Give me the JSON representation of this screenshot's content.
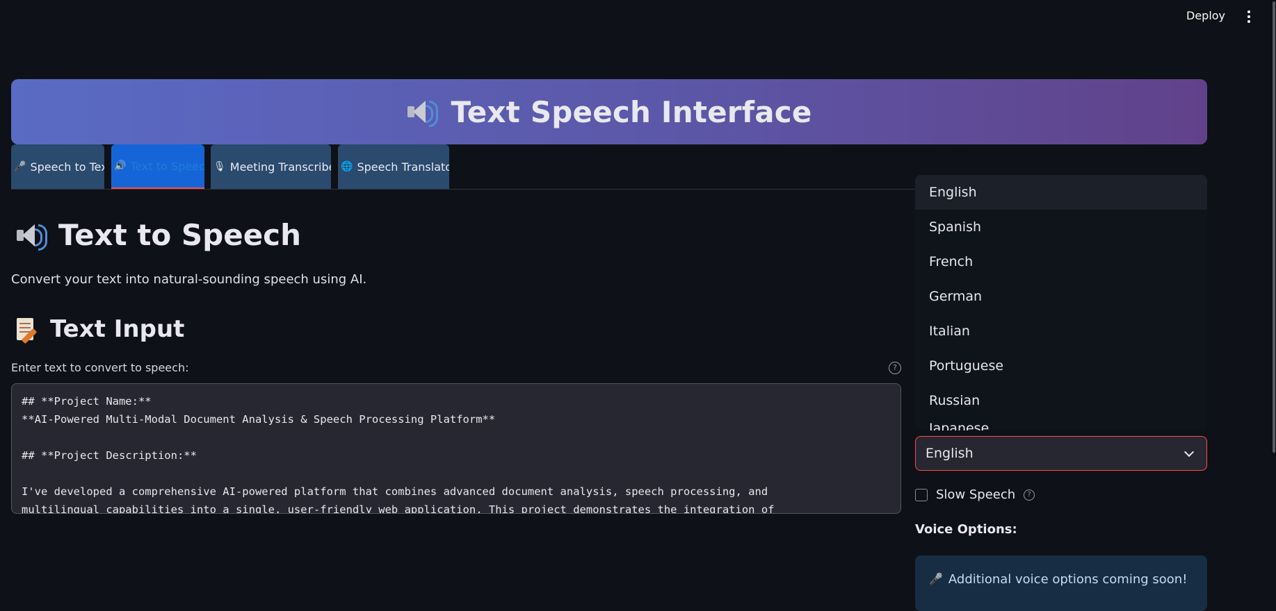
{
  "header": {
    "deploy_label": "Deploy"
  },
  "hero": {
    "title": "Text Speech Interface",
    "icon": "speaker-icon"
  },
  "tabs": [
    {
      "label": "Speech to Text",
      "icon": "microphone-icon",
      "active": false
    },
    {
      "label": "Text to Speech",
      "icon": "speaker-icon",
      "active": true
    },
    {
      "label": "Meeting Transcriber",
      "icon": "studio-microphone-icon",
      "active": false
    },
    {
      "label": "Speech Translator",
      "icon": "globe-icon",
      "active": false
    }
  ],
  "main": {
    "title": "Text to Speech",
    "description": "Convert your text into natural-sounding speech using AI.",
    "input_section_title": "Text Input",
    "input_label": "Enter text to convert to speech:",
    "input_value": "## **Project Name:**\n**AI-Powered Multi-Modal Document Analysis & Speech Processing Platform**\n\n## **Project Description:**\n\nI've developed a comprehensive AI-powered platform that combines advanced document analysis, speech processing, and\nmultilingual capabilities into a single, user-friendly web application. This project demonstrates the integration of"
  },
  "language": {
    "options": [
      "English",
      "Spanish",
      "French",
      "German",
      "Italian",
      "Portuguese",
      "Russian",
      "Japanese"
    ],
    "highlighted": "English",
    "selected": "English"
  },
  "slow_speech": {
    "label": "Slow Speech",
    "checked": false
  },
  "voice": {
    "title": "Voice Options:",
    "info": "Additional voice options coming soon!"
  },
  "colors": {
    "background": "#0e1117",
    "accent": "#ff4b4b",
    "tab_bg": "#2a4a6e",
    "tab_active_bg": "#1565d8",
    "info_bg": "#172d43"
  }
}
